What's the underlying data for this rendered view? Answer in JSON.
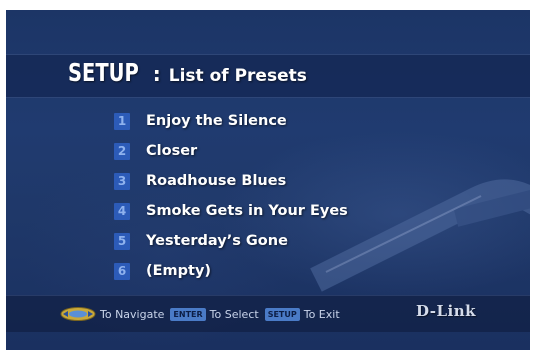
{
  "header": {
    "title_main": "SETUP",
    "title_separator": ":",
    "title_sub": "List of Presets"
  },
  "presets": [
    {
      "number": "1",
      "name": "Enjoy the Silence"
    },
    {
      "number": "2",
      "name": "Closer"
    },
    {
      "number": "3",
      "name": "Roadhouse Blues"
    },
    {
      "number": "4",
      "name": "Smoke Gets in Your Eyes"
    },
    {
      "number": "5",
      "name": "Yesterday’s Gone"
    },
    {
      "number": "6",
      "name": "(Empty)"
    }
  ],
  "footer": {
    "navigate_icon": "nav-arrows-icon",
    "navigate_label": "To Navigate",
    "enter_key": "ENTER",
    "select_label": "To Select",
    "setup_key": "SETUP",
    "exit_label": "To Exit"
  },
  "brand": {
    "logo_text": "D-Link"
  },
  "colors": {
    "background": "#1f3869",
    "number_badge": "#2c5bb8",
    "text": "#ffffff",
    "key_badge": "#4a7bc7"
  }
}
